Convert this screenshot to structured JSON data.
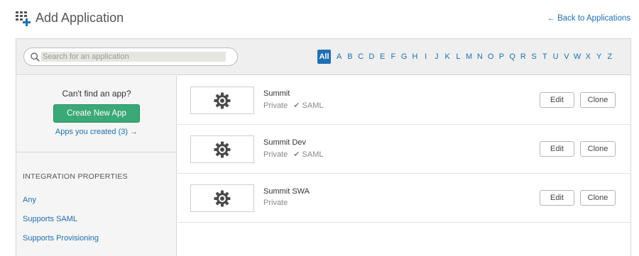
{
  "header": {
    "title": "Add Application",
    "back_link": "← Back to Applications"
  },
  "search": {
    "placeholder": "Search for an application"
  },
  "alphabet": [
    "All",
    "A",
    "B",
    "C",
    "D",
    "E",
    "F",
    "G",
    "H",
    "I",
    "J",
    "K",
    "L",
    "M",
    "N",
    "O",
    "P",
    "Q",
    "R",
    "S",
    "T",
    "U",
    "V",
    "W",
    "X",
    "Y",
    "Z"
  ],
  "alphabet_active": "All",
  "sidebar": {
    "cant_find": "Can't find an app?",
    "create_button": "Create New App",
    "apps_created": "Apps you created (3) →",
    "properties_heading": "INTEGRATION PROPERTIES",
    "properties": [
      "Any",
      "Supports SAML",
      "Supports Provisioning"
    ]
  },
  "apps": [
    {
      "name": "Summit",
      "visibility": "Private",
      "saml": "✔ SAML",
      "edit": "Edit",
      "clone": "Clone",
      "icon": "gear-icon"
    },
    {
      "name": "Summit Dev",
      "visibility": "Private",
      "saml": "✔ SAML",
      "edit": "Edit",
      "clone": "Clone",
      "icon": "gear-icon"
    },
    {
      "name": "Summit SWA",
      "visibility": "Private",
      "saml": "",
      "edit": "Edit",
      "clone": "Clone",
      "icon": "gear-icon"
    }
  ],
  "colors": {
    "accent": "#1f6fb2",
    "create_button": "#3aa877"
  }
}
